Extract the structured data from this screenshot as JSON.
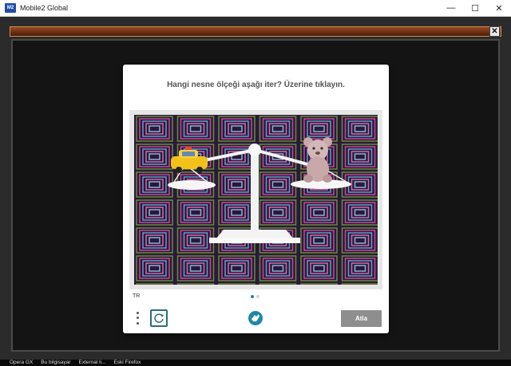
{
  "window": {
    "title": "Mobile2 Global",
    "icon_label": "M2",
    "minimize": "—",
    "maximize": "☐",
    "close": "✕"
  },
  "game": {
    "close_label": "✕"
  },
  "captcha": {
    "prompt": "Hangi nesne ölçeği aşağı iter? Üzerine tıklayın.",
    "language": "TR",
    "skip_label": "Atla",
    "left_object": "taxi-car",
    "right_object": "teddy-bear",
    "page_count": 2,
    "active_page": 1,
    "accent_color": "#1e88a8"
  },
  "taskbar": {
    "items": [
      "Opera GX",
      "Bu bilgisayar",
      "External li...",
      "Eski Firefox"
    ]
  }
}
